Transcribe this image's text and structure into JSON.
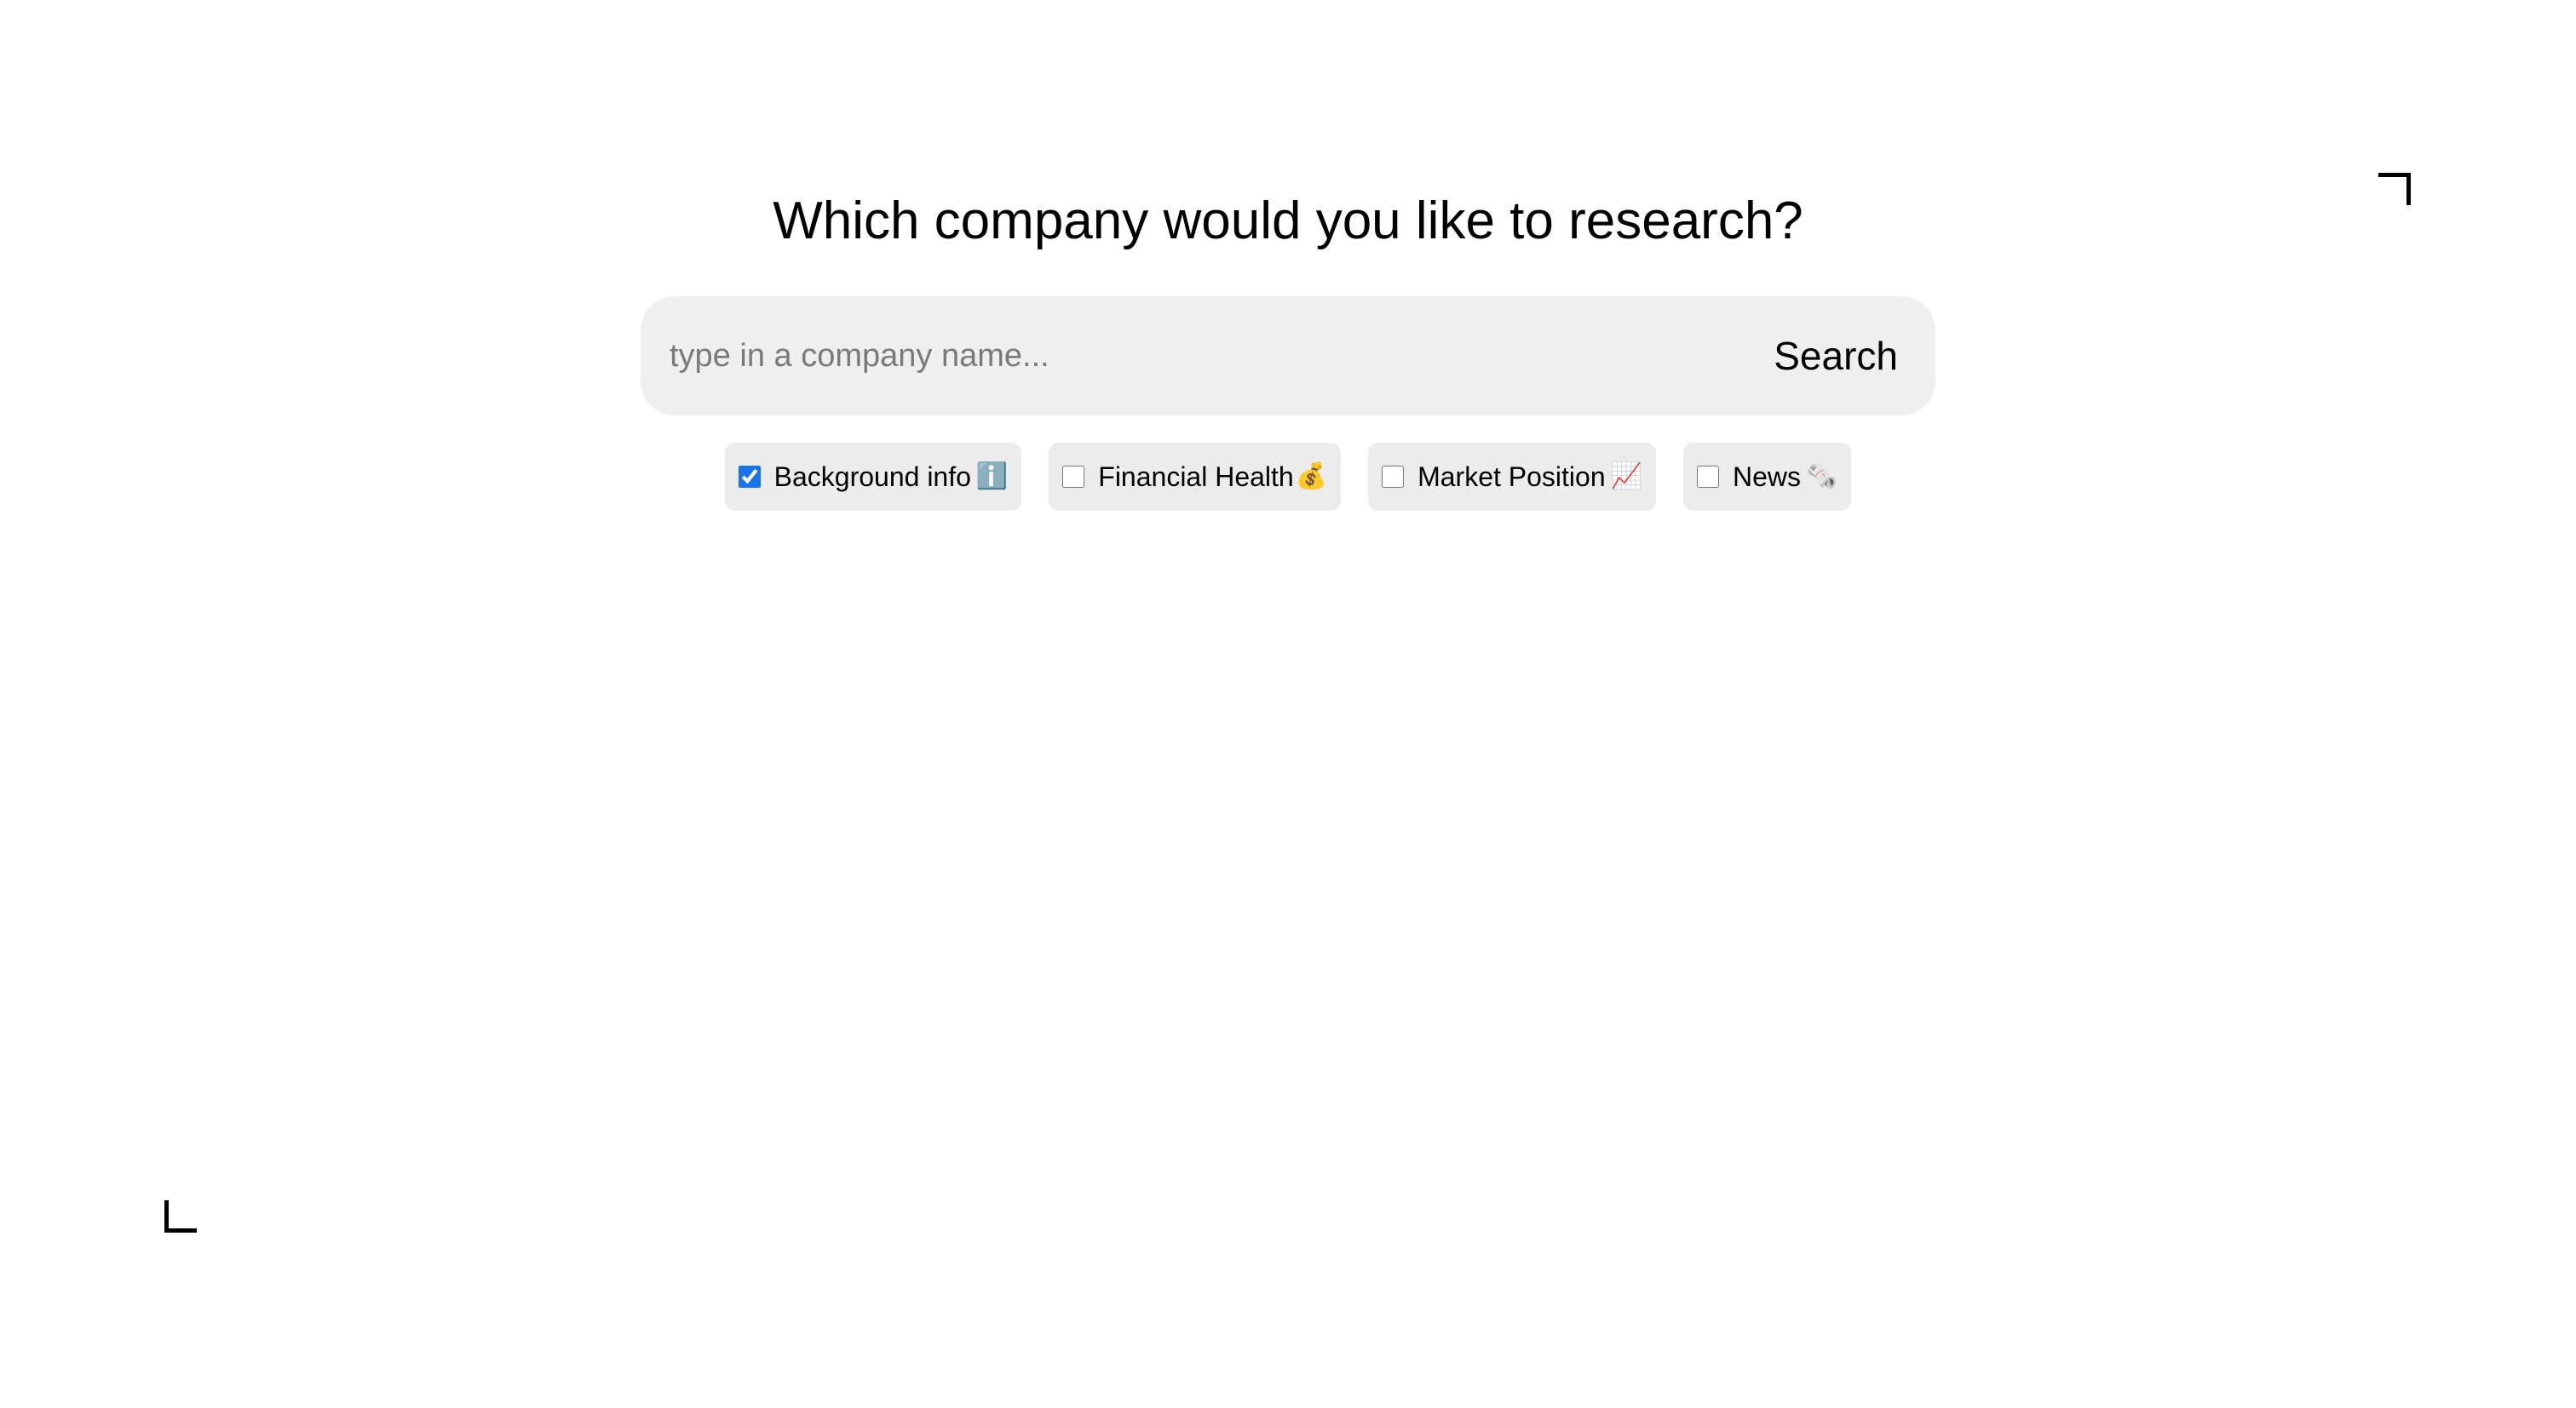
{
  "heading": "Which company would you like to research?",
  "search": {
    "placeholder": "type in a company name...",
    "value": "",
    "button_label": "Search"
  },
  "filters": [
    {
      "label": "Background info",
      "icon": "info-icon",
      "glyph": "ℹ️",
      "checked": true
    },
    {
      "label": "Financial Health",
      "icon": "money-bag-icon",
      "glyph": "💰",
      "checked": false
    },
    {
      "label": "Market Position",
      "icon": "chart-increasing-icon",
      "glyph": "📈",
      "checked": false
    },
    {
      "label": "News",
      "icon": "newspaper-icon",
      "glyph": "🗞️",
      "checked": false
    }
  ]
}
